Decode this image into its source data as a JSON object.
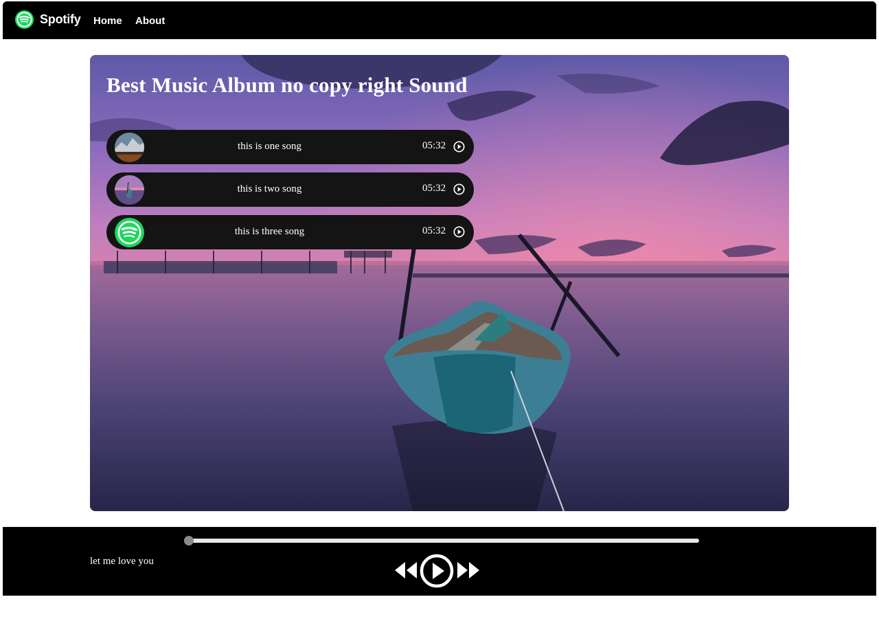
{
  "navbar": {
    "brand": "Spotify",
    "links": [
      "Home",
      "About"
    ]
  },
  "hero": {
    "title": "Best Music Album no copy right Sound"
  },
  "songs": [
    {
      "title": "this is one song",
      "duration": "05:32",
      "thumb": "mountain-cover"
    },
    {
      "title": "this is two song",
      "duration": "05:32",
      "thumb": "sunset-cover"
    },
    {
      "title": "this is three song",
      "duration": "05:32",
      "thumb": "spotify-logo"
    }
  ],
  "player": {
    "now_playing": "let me love you",
    "progress": 0
  },
  "icons": {
    "brand": "spotify-logo-icon",
    "song_play": "play-circle-icon",
    "previous": "backward-icon",
    "play": "play-circle-icon",
    "next": "forward-icon"
  },
  "colors": {
    "navbar_bg": "#000000",
    "player_bg": "#000000",
    "song_bg": "#141414",
    "spotify_green": "#1ed760"
  }
}
